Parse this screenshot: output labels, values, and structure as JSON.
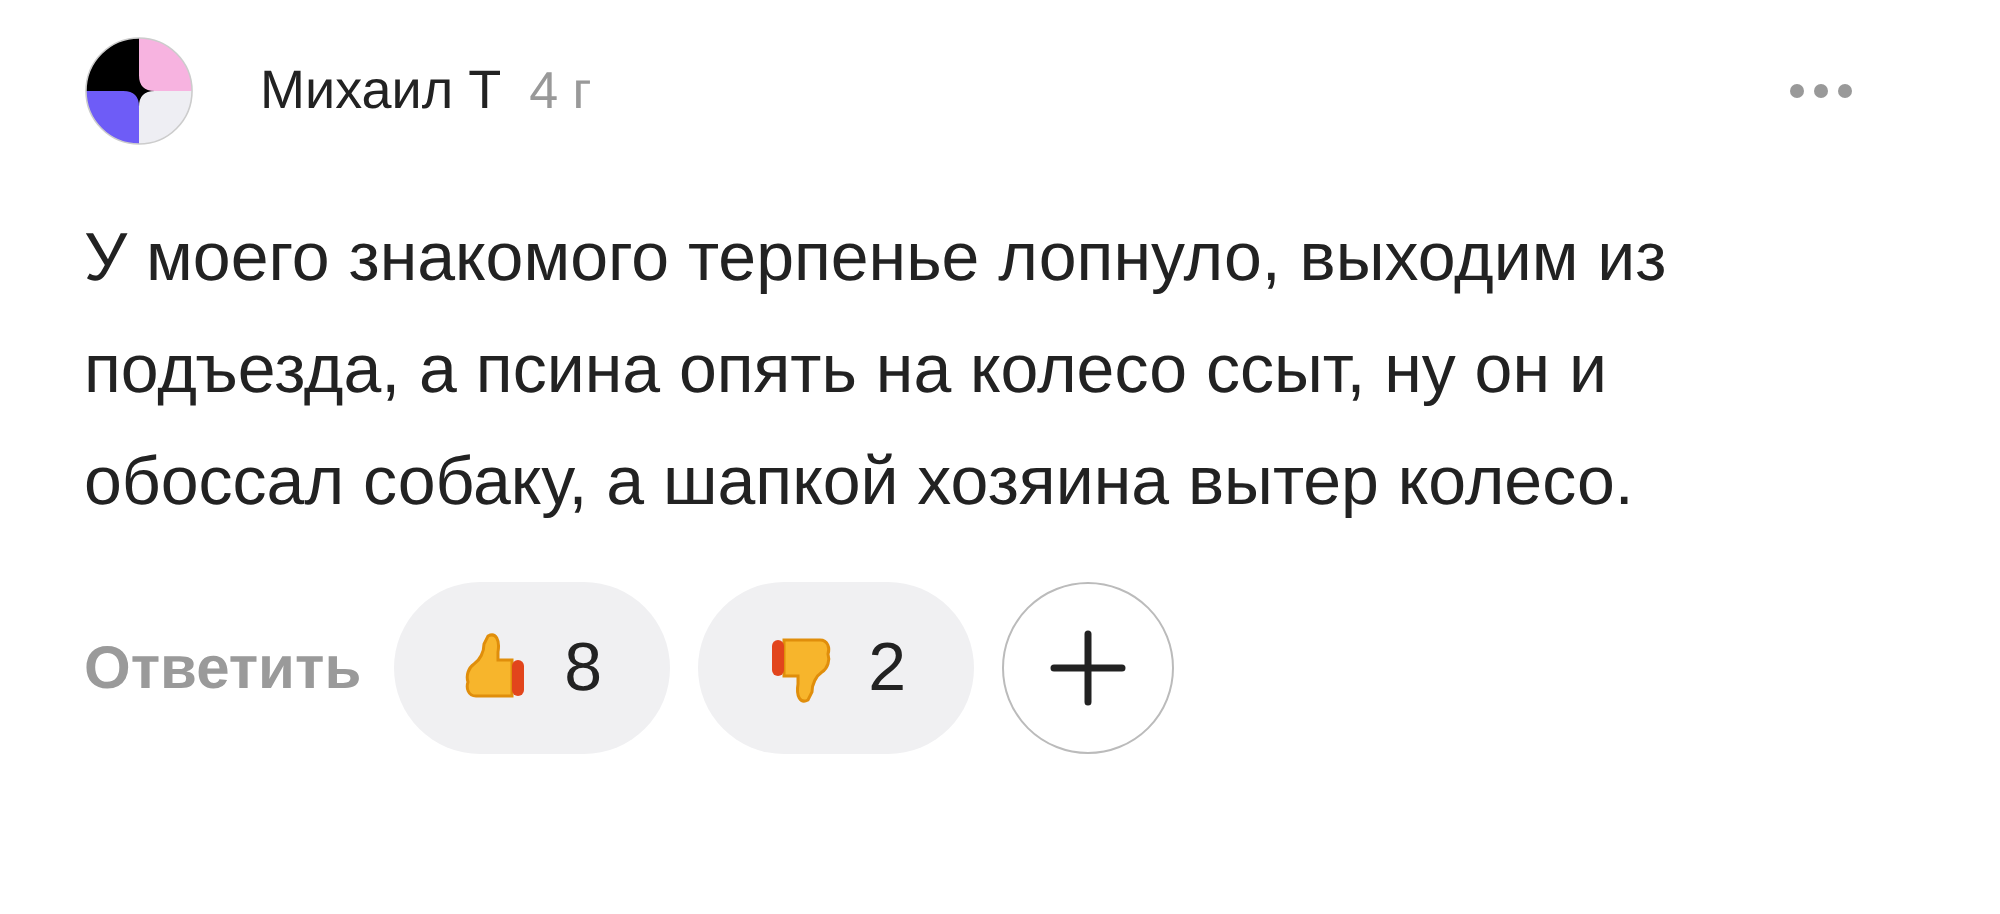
{
  "comment": {
    "author": "Михаил Т",
    "age": "4 г",
    "text": "У моего знакомого терпенье лопнуло, выходим из подъезда, а псина опять на колесо ссыт, ну он и обоссал собаку, а шапкой хозяина вытер колесо.",
    "reply": "Ответить",
    "reactions": [
      {
        "kind": "like",
        "count": "8"
      },
      {
        "kind": "dislike",
        "count": "2"
      }
    ]
  }
}
